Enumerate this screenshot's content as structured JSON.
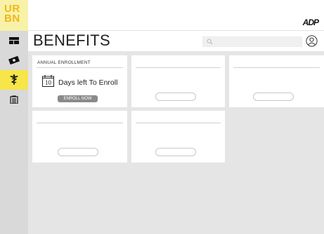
{
  "brand": {
    "logo_line1": "UR",
    "logo_line2": "BN",
    "partner": "ADP"
  },
  "sidebar": {
    "items": [
      {
        "icon": "dashboard-icon",
        "active": false
      },
      {
        "icon": "money-icon",
        "active": false
      },
      {
        "icon": "caduceus-icon",
        "active": true
      },
      {
        "icon": "building-icon",
        "active": false
      }
    ]
  },
  "header": {
    "title": "BENEFITS",
    "search_placeholder": ""
  },
  "tiles": [
    {
      "title": "ANNUAL ENROLLMENT",
      "calendar_day": "10",
      "text": "Days left To Enroll",
      "button_label": "ENROLL NOW"
    },
    {
      "title": "",
      "button_label": ""
    },
    {
      "title": "",
      "button_label": ""
    },
    {
      "title": "",
      "button_label": ""
    },
    {
      "title": "",
      "button_label": ""
    }
  ],
  "colors": {
    "logo_bg": "#f7f2a8",
    "logo_text": "#f2b618",
    "active_nav": "#f7e64a",
    "sidebar_bg": "#d9d9d9",
    "content_bg": "#e5e5e5",
    "button_bg": "#8a8a8a"
  }
}
